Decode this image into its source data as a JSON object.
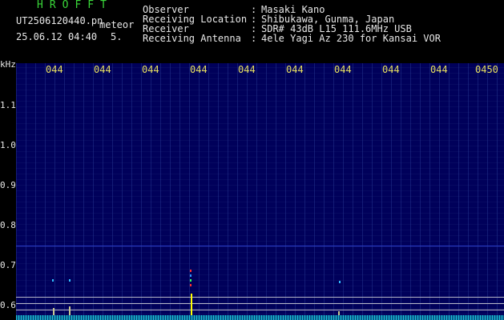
{
  "header": {
    "app_title": "HROFFT",
    "file_name": "UT2506120440.pn",
    "mode_label": "meteor",
    "datetime": "25.06.12 04:40",
    "count": "5.",
    "info": [
      {
        "key": "Observer",
        "value": "Masaki Kano"
      },
      {
        "key": "Receiving Location",
        "value": "Shibukawa, Gunma, Japan"
      },
      {
        "key": "Receiver",
        "value": "SDR# 43dB L15 111.6MHz USB"
      },
      {
        "key": "Receiving Antenna",
        "value": "4ele Yagi Az 230 for Kansai VOR"
      }
    ],
    "separator": ":"
  },
  "spectrogram": {
    "unit_label": "kHz",
    "x_ticks": [
      "044",
      "044",
      "044",
      "044",
      "044",
      "044",
      "044",
      "044",
      "044",
      "0450"
    ],
    "y_ticks": [
      "1.1",
      "1.0",
      "0.9",
      "0.8",
      "0.7",
      "0.6"
    ],
    "colors": {
      "background": "#00005a",
      "signal": "#ffff00",
      "hline": "#c8c8c8",
      "noise": "#1ac0d8"
    }
  }
}
